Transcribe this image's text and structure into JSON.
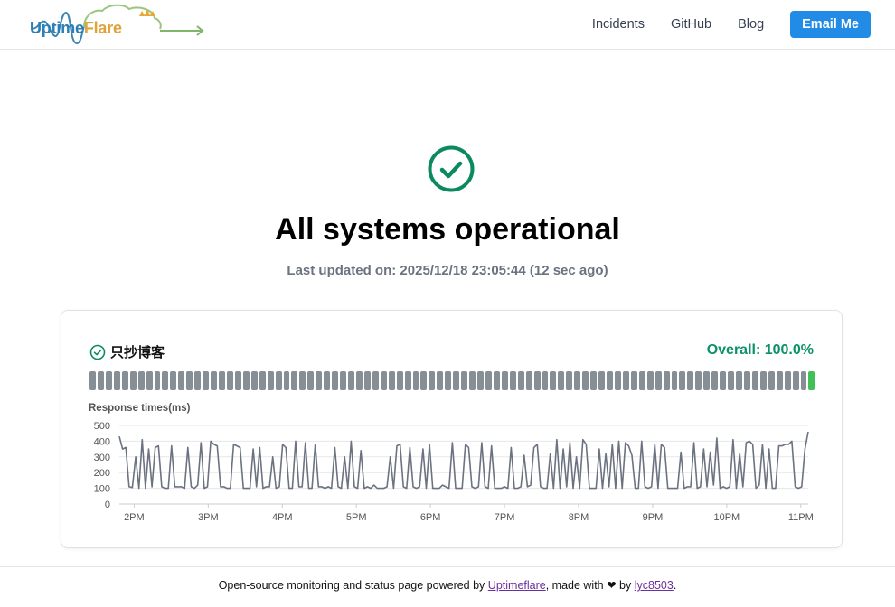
{
  "header": {
    "logo_prefix": "Uptime",
    "logo_suffix": "Flare",
    "nav": [
      "Incidents",
      "GitHub",
      "Blog"
    ],
    "cta_label": "Email Me"
  },
  "hero": {
    "title": "All systems operational",
    "updated": "Last updated on: 2025/12/18 23:05:44 (12 sec ago)",
    "status_color": "#0c8a5f"
  },
  "monitor": {
    "name": "只抄博客",
    "overall": "Overall: 100.0%",
    "bar_count": 90,
    "up_bar_index": 89,
    "bar_color": "#868e96",
    "up_color": "#40c057",
    "chart_label": "Response times(ms)"
  },
  "chart_data": {
    "type": "line",
    "title": "",
    "xlabel": "",
    "ylabel": "Response times(ms)",
    "ylim": [
      0,
      500
    ],
    "yticks": [
      0,
      100,
      200,
      300,
      400,
      500
    ],
    "xticks": [
      "2PM",
      "3PM",
      "4PM",
      "5PM",
      "6PM",
      "7PM",
      "8PM",
      "9PM",
      "10PM",
      "11PM"
    ],
    "x_start_hour": 13.8,
    "x_end_hour": 23.1,
    "series": [
      {
        "color": "#6b7280",
        "values": [
          430,
          350,
          360,
          110,
          105,
          300,
          100,
          410,
          100,
          350,
          110,
          360,
          370,
          110,
          100,
          100,
          370,
          110,
          110,
          110,
          100,
          360,
          110,
          100,
          120,
          390,
          100,
          110,
          400,
          380,
          370,
          110,
          110,
          100,
          100,
          380,
          370,
          360,
          100,
          100,
          100,
          350,
          110,
          360,
          100,
          110,
          110,
          300,
          100,
          110,
          380,
          360,
          100,
          100,
          400,
          110,
          110,
          390,
          100,
          100,
          380,
          110,
          110,
          100,
          110,
          100,
          360,
          110,
          100,
          300,
          100,
          400,
          110,
          100,
          340,
          100,
          110,
          100,
          120,
          100,
          100,
          100,
          110,
          300,
          100,
          370,
          380,
          110,
          100,
          360,
          110,
          100,
          110,
          350,
          100,
          380,
          100,
          100,
          100,
          120,
          110,
          100,
          390,
          100,
          100,
          100,
          380,
          360,
          110,
          100,
          110,
          390,
          110,
          100,
          370,
          100,
          100,
          100,
          110,
          100,
          360,
          100,
          100,
          110,
          310,
          110,
          120,
          360,
          380,
          110,
          100,
          100,
          320,
          100,
          410,
          100,
          350,
          110,
          390,
          100,
          300,
          100,
          410,
          380,
          100,
          100,
          100,
          350,
          100,
          320,
          110,
          380,
          100,
          400,
          100,
          390,
          370,
          310,
          100,
          100,
          400,
          110,
          100,
          110,
          380,
          100,
          380,
          360,
          100,
          100,
          100,
          100,
          330,
          100,
          110,
          110,
          390,
          100,
          110,
          350,
          110,
          330,
          120,
          420,
          100,
          110,
          100,
          110,
          410,
          100,
          320,
          110,
          390,
          400,
          380,
          100,
          120,
          380,
          100,
          350,
          100,
          100,
          370,
          370,
          380,
          380,
          400,
          110,
          100,
          110,
          350,
          460
        ]
      }
    ]
  },
  "footer": {
    "text_before": "Open-source monitoring and status page powered by ",
    "link1": "Uptimeflare",
    "text_mid": ", made with ❤ by ",
    "link2": "lyc8503",
    "text_end": "."
  }
}
